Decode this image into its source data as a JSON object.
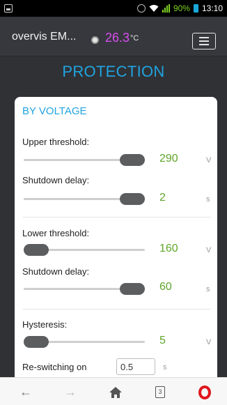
{
  "status_bar": {
    "battery_percent": "90%",
    "time": "13:10",
    "icons": [
      "alarm-icon",
      "wifi-icon",
      "signal-icon",
      "battery-icon"
    ]
  },
  "app": {
    "title": "overvis EM...",
    "temperature": "26.3",
    "temperature_unit": "°C"
  },
  "page": {
    "section_title": "PROTECTION"
  },
  "card": {
    "title": "BY VOLTAGE",
    "upper": {
      "label": "Upper threshold:",
      "value": "290",
      "unit": "V",
      "slider_level": 0.85
    },
    "upper_delay": {
      "label": "Shutdown delay:",
      "value": "2",
      "unit": "s",
      "slider_level": 0.85
    },
    "lower": {
      "label": "Lower threshold:",
      "value": "160",
      "unit": "V",
      "slider_level": 0.0
    },
    "lower_delay": {
      "label": "Shutdown delay:",
      "value": "60",
      "unit": "s",
      "slider_level": 0.85
    },
    "hysteresis": {
      "label": "Hysteresis:",
      "value": "5",
      "unit": "V",
      "slider_level": 0.0
    },
    "reswitch": {
      "label": "Re-switching on delay",
      "value": "0.5",
      "unit": "s"
    }
  },
  "colors": {
    "accent": "#21a4e0",
    "value": "#5fa52a",
    "temperature": "#d94df0",
    "opera": "#e0161c"
  },
  "nav": {
    "tab_count": "3",
    "icons": [
      "back-arrow-icon",
      "forward-arrow-icon",
      "home-icon",
      "tabs-icon",
      "opera-icon"
    ]
  }
}
